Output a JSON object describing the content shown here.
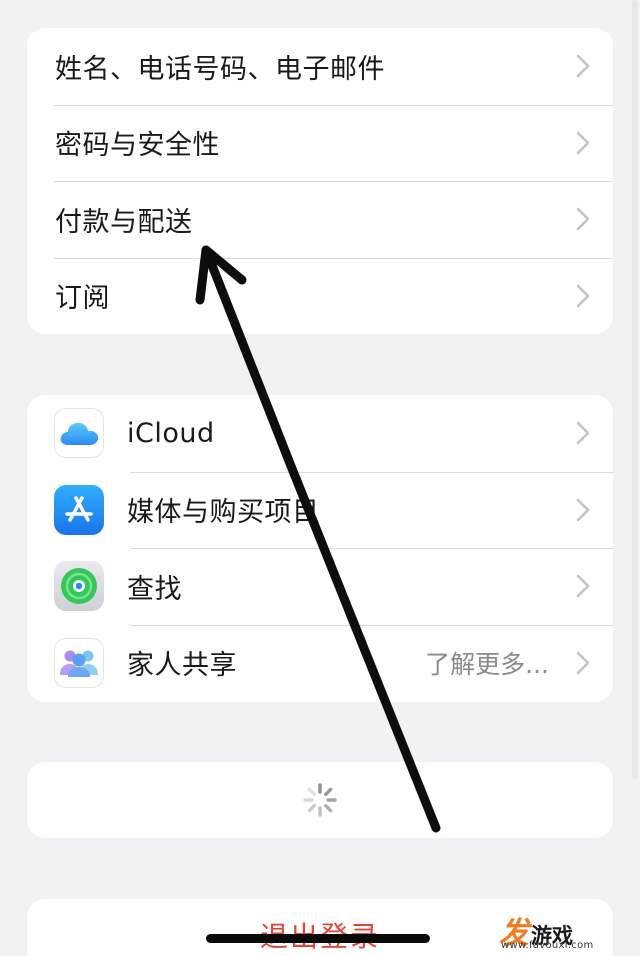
{
  "account_section": {
    "items": [
      {
        "label": "姓名、电话号码、电子邮件"
      },
      {
        "label": "密码与安全性"
      },
      {
        "label": "付款与配送"
      },
      {
        "label": "订阅"
      }
    ]
  },
  "services_section": {
    "items": [
      {
        "label": "iCloud",
        "icon": "icloud-icon"
      },
      {
        "label": "媒体与购买项目",
        "icon": "app-store-icon"
      },
      {
        "label": "查找",
        "icon": "find-my-icon"
      },
      {
        "label": "家人共享",
        "icon": "family-sharing-icon",
        "detail": "了解更多..."
      }
    ]
  },
  "loading_section": {
    "icon": "spinner-icon"
  },
  "signout": {
    "label": "退出登录"
  },
  "watermark": {
    "logo": "发",
    "name": "游戏",
    "url": "www.favouxi.com"
  },
  "colors": {
    "background": "#f1f1f6",
    "card": "#ffffff",
    "destructive": "#e6423a",
    "secondary_text": "#8a8a8e",
    "chevron": "#c4c4c8"
  }
}
